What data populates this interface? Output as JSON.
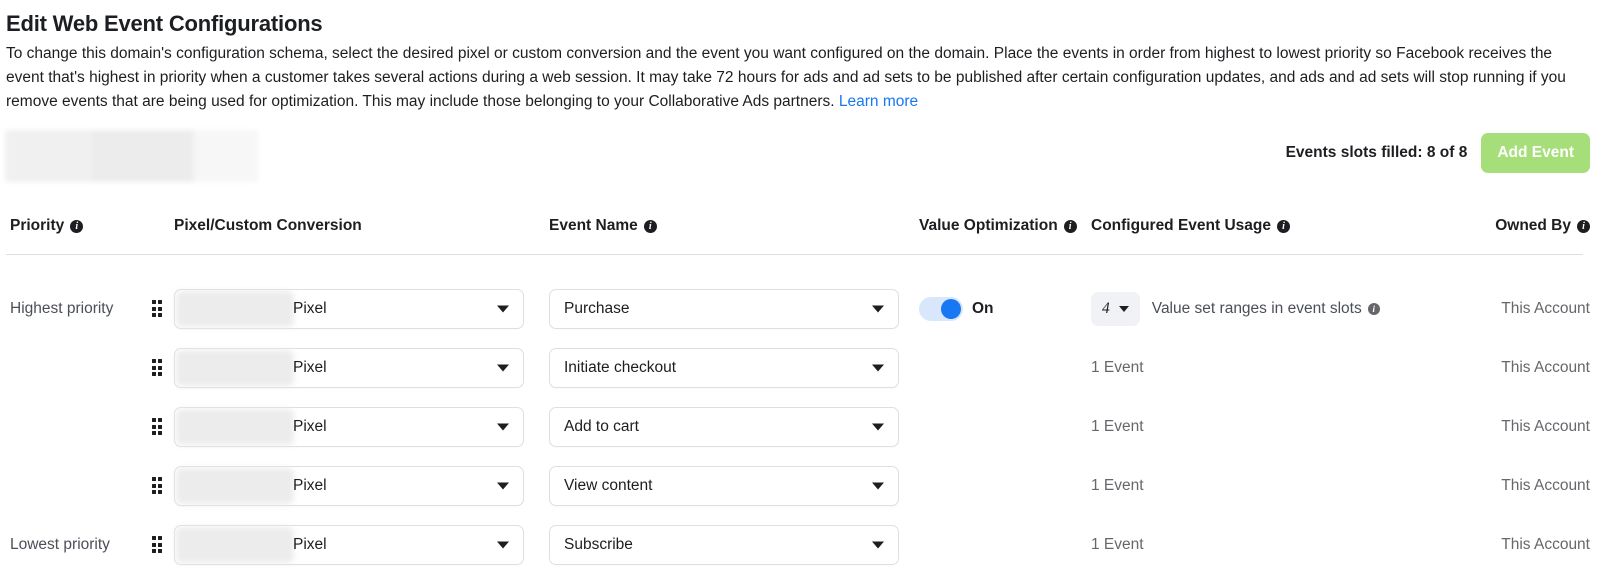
{
  "header": {
    "title": "Edit Web Event Configurations",
    "description": "To change this domain's configuration schema, select the desired pixel or custom conversion and the event you want configured on the domain. Place the events in order from highest to lowest priority so Facebook receives the event that's highest in priority when a customer takes several actions during a web session. It may take 72 hours for ads and ad sets to be published after certain configuration updates, and ads and ad sets will stop running if you remove events that are being used for optimization. This may include those belonging to your Collaborative Ads partners.",
    "learn_more": "Learn more",
    "link_color": "#1877f2"
  },
  "toolbar": {
    "slots_filled": "Events slots filled: 8 of 8",
    "add_event_label": "Add Event",
    "add_event_color": "#a6df79",
    "add_event_disabled": "true"
  },
  "table": {
    "columns": [
      {
        "label": "Priority",
        "has_info": "true"
      },
      {
        "label": "Pixel/Custom Conversion",
        "has_info": "false"
      },
      {
        "label": "Event Name",
        "has_info": "true"
      },
      {
        "label": "Value Optimization",
        "has_info": "true"
      },
      {
        "label": "Configured Event Usage",
        "has_info": "true"
      },
      {
        "label": "Owned By",
        "has_info": "true"
      }
    ],
    "info_glyph": "i",
    "rows": [
      {
        "priority_label": "Highest priority",
        "pixel": "Pixel",
        "event_name": "Purchase",
        "value_optimization": "On",
        "value_optimization_on": "true",
        "usage_count": "4",
        "usage_note": "Value set ranges in event slots",
        "usage_plain": "",
        "owned_by": "This Account"
      },
      {
        "priority_label": "",
        "pixel": "Pixel",
        "event_name": "Initiate checkout",
        "value_optimization": "",
        "value_optimization_on": "false",
        "usage_count": "",
        "usage_note": "",
        "usage_plain": "1 Event",
        "owned_by": "This Account"
      },
      {
        "priority_label": "",
        "pixel": "Pixel",
        "event_name": "Add to cart",
        "value_optimization": "",
        "value_optimization_on": "false",
        "usage_count": "",
        "usage_note": "",
        "usage_plain": "1 Event",
        "owned_by": "This Account"
      },
      {
        "priority_label": "",
        "pixel": "Pixel",
        "event_name": "View content",
        "value_optimization": "",
        "value_optimization_on": "false",
        "usage_count": "",
        "usage_note": "",
        "usage_plain": "1 Event",
        "owned_by": "This Account"
      },
      {
        "priority_label": "Lowest priority",
        "pixel": "Pixel",
        "event_name": "Subscribe",
        "value_optimization": "",
        "value_optimization_on": "false",
        "usage_count": "",
        "usage_note": "",
        "usage_plain": "1 Event",
        "owned_by": "This Account"
      }
    ]
  }
}
